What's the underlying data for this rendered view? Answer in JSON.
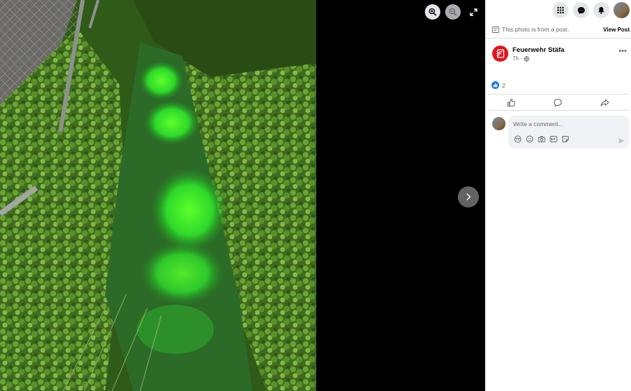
{
  "viewer": {
    "icons": {
      "zoom_in": "zoom-in-icon",
      "zoom_out": "zoom-out-icon",
      "fullscreen": "expand-icon",
      "next": "chevron-right-icon"
    }
  },
  "topbar": {
    "icons": [
      "menu-grid-icon",
      "messenger-icon",
      "bell-icon",
      "avatar"
    ]
  },
  "notice": {
    "text": "This photo is from a post.",
    "link": "View Post"
  },
  "post": {
    "author": "Feuerwehr Stäfa",
    "time": "7h",
    "audience_icon": "globe-icon",
    "more": "•••",
    "reactions": {
      "icon": "like-icon",
      "count": "2"
    }
  },
  "comment": {
    "placeholder": "Write a comment...",
    "tools": [
      "avatar-sticker-icon",
      "emoji-icon",
      "camera-icon",
      "gif-icon",
      "sticker-icon"
    ]
  },
  "colors": {
    "brand": "#e0141c",
    "accent": "#1877f2"
  }
}
